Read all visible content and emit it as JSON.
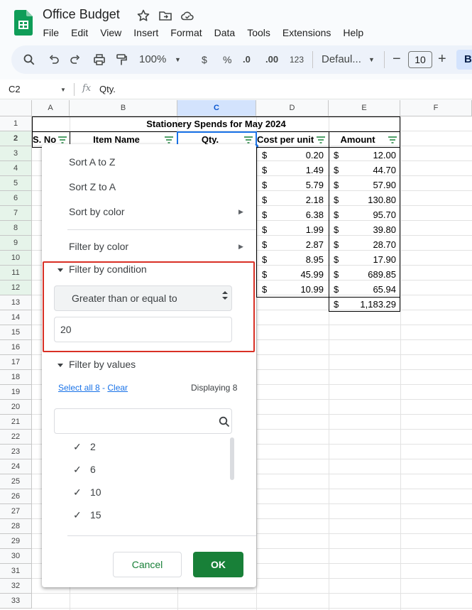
{
  "doc": {
    "title": "Office Budget",
    "menus": [
      "File",
      "Edit",
      "View",
      "Insert",
      "Format",
      "Data",
      "Tools",
      "Extensions",
      "Help"
    ]
  },
  "toolbar": {
    "zoom": "100%",
    "currency": "$",
    "percent": "%",
    "dec_dec": ".0",
    "inc_dec": ".00",
    "numfmt": "123",
    "font": "Defaul...",
    "font_size": "10",
    "bold": "B"
  },
  "formula": {
    "cell": "C2",
    "fx": "fx",
    "value": "Qty."
  },
  "columns": [
    "A",
    "B",
    "C",
    "D",
    "E",
    "F"
  ],
  "rows": [
    "1",
    "2",
    "3",
    "4",
    "5",
    "6",
    "7",
    "8",
    "9",
    "10",
    "11",
    "12",
    "13",
    "14",
    "15",
    "16",
    "17",
    "18",
    "19",
    "20",
    "21",
    "22",
    "23",
    "24",
    "25",
    "26",
    "27",
    "28",
    "29",
    "30",
    "31",
    "32",
    "33"
  ],
  "sheet": {
    "title": "Stationery Spends for May 2024",
    "headers": {
      "sno": "S. No",
      "item": "Item Name",
      "qty": "Qty.",
      "cpu": "Cost per unit",
      "amount": "Amount"
    },
    "currency": "$",
    "cost_per_unit": [
      "0.20",
      "1.49",
      "5.79",
      "2.18",
      "6.38",
      "1.99",
      "2.87",
      "8.95",
      "45.99",
      "10.99"
    ],
    "amounts": [
      "12.00",
      "44.70",
      "57.90",
      "130.80",
      "95.70",
      "39.80",
      "28.70",
      "17.90",
      "689.85",
      "65.94"
    ],
    "total": "1,183.29"
  },
  "filter": {
    "sort_az": "Sort A to Z",
    "sort_za": "Sort Z to A",
    "sort_color": "Sort by color",
    "filter_color": "Filter by color",
    "by_condition": "Filter by condition",
    "condition": "Greater than or equal to",
    "condition_value": "20",
    "by_values": "Filter by values",
    "select_all": "Select all 8",
    "dash": " - ",
    "clear": "Clear",
    "displaying": "Displaying 8",
    "values": [
      "2",
      "6",
      "10",
      "15"
    ],
    "cancel": "Cancel",
    "ok": "OK"
  },
  "colors": {
    "accent": "#188038",
    "highlight": "#d93025",
    "link": "#1a73e8"
  }
}
